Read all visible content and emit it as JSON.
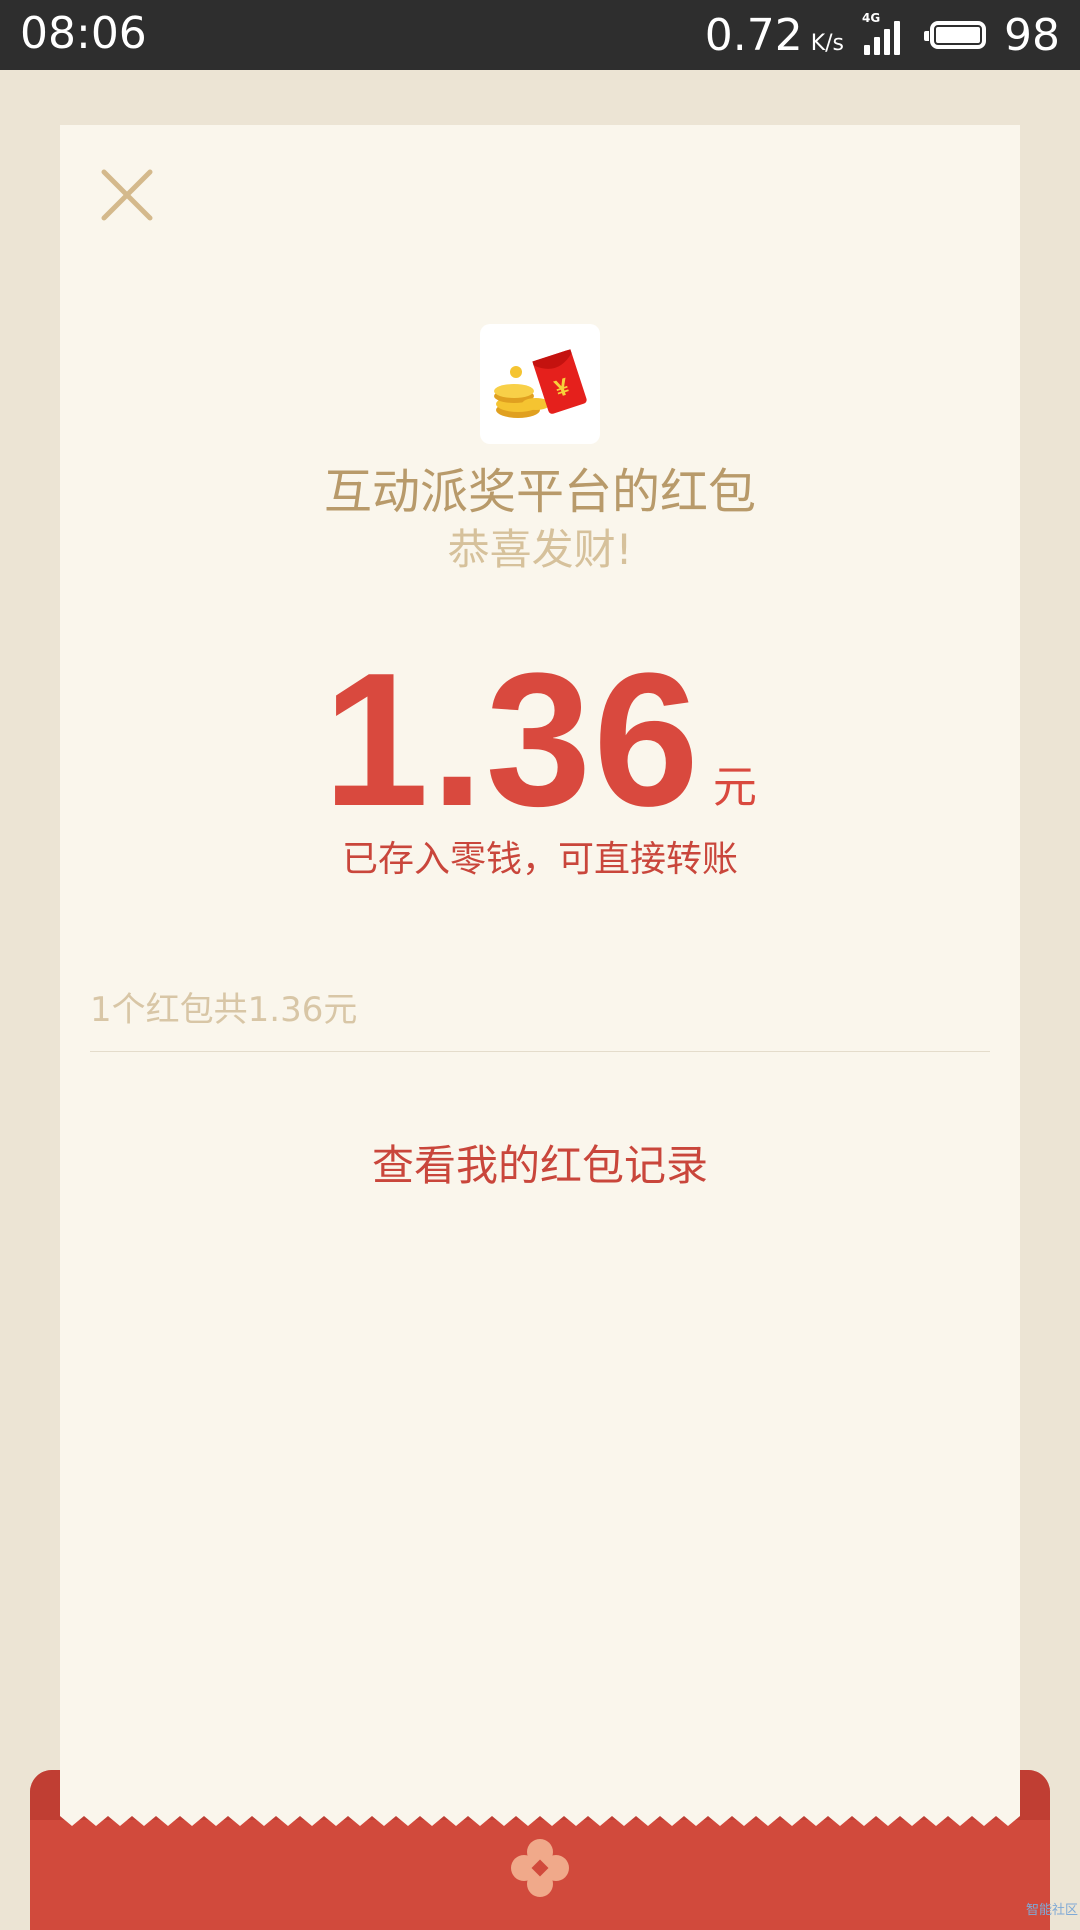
{
  "status_bar": {
    "time": "08:06",
    "net_speed": "0.72",
    "net_unit": "K/s",
    "network_type": "4G",
    "battery_level": "98",
    "icons": [
      "signal-icon",
      "battery-icon"
    ]
  },
  "card": {
    "close_icon": "close-icon",
    "sender_name": "互动派奖平台的红包",
    "greeting": "恭喜发财!",
    "amount": "1.36",
    "amount_unit": "元",
    "stored_note": "已存入零钱，可直接转账",
    "summary": "1个红包共1.36元",
    "records_link": "查看我的红包记录"
  },
  "watermark": "智能社区",
  "colors": {
    "amount": "#d9493e",
    "sender": "#b89a6a",
    "envelope": "#d14a3c",
    "card_bg": "#faf6ec",
    "page_bg": "#ece4d4"
  }
}
